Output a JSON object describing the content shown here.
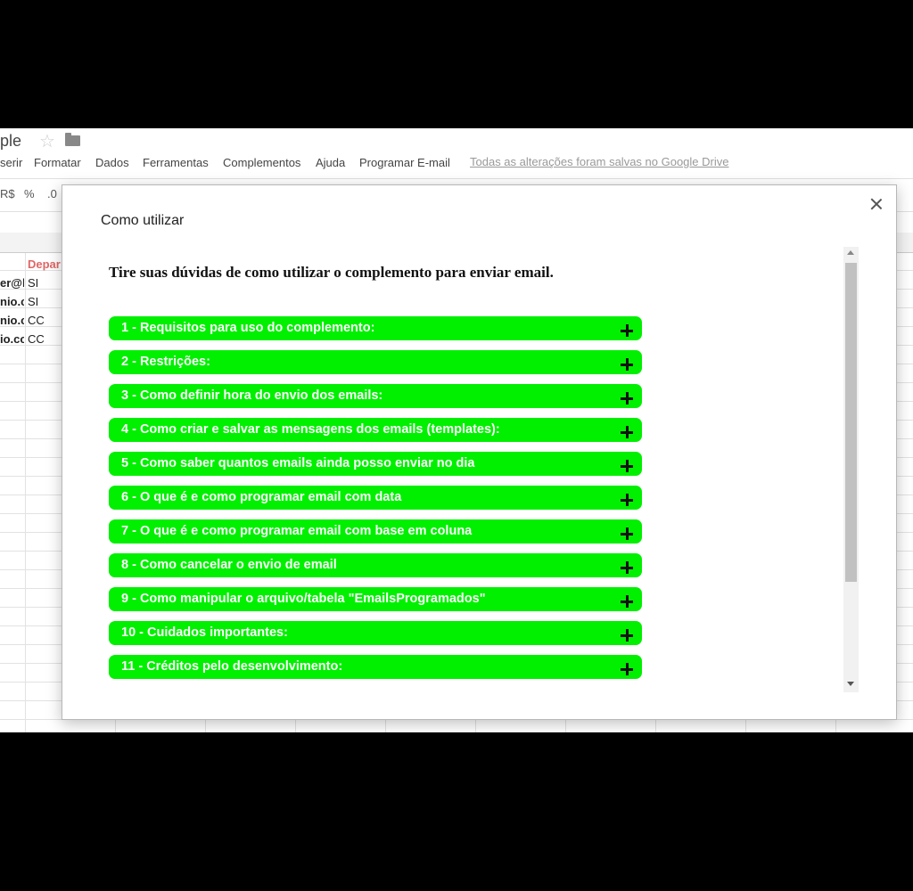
{
  "app": {
    "title": "ple",
    "menu": [
      "serir",
      "Formatar",
      "Dados",
      "Ferramentas",
      "Complementos",
      "Ajuda",
      "Programar E-mail"
    ],
    "saved_status": "Todas as alterações foram salvas no Google Drive",
    "toolbar": {
      "currency": "R$",
      "percent": "%",
      "decimal": ".0"
    }
  },
  "sheet": {
    "header_cell": "Depar",
    "rows": [
      {
        "col_a": "er@h",
        "col_b": "SI"
      },
      {
        "col_a": "nio.c",
        "col_b": "SI"
      },
      {
        "col_a": "nio.c",
        "col_b": "CC"
      },
      {
        "col_a": "io.co",
        "col_b": "CC"
      }
    ]
  },
  "dialog": {
    "title": "Como utilizar",
    "heading": "Tire suas dúvidas de como utilizar o complemento para enviar email.",
    "items": [
      "1 - Requisitos para uso do complemento:",
      "2 - Restrições:",
      "3 - Como definir hora do envio dos emails:",
      "4 - Como criar e salvar as mensagens dos emails (templates):",
      "5 - Como saber quantos emails ainda posso enviar no dia",
      "6 - O que é e como programar email com data",
      "7 - O que é e como programar email com base em coluna",
      "8 - Como cancelar o envio de email",
      "9 - Como manipular o arquivo/tabela \"EmailsProgramados\"",
      "10 - Cuidados importantes:",
      "11 - Créditos pelo desenvolvimento:"
    ]
  }
}
